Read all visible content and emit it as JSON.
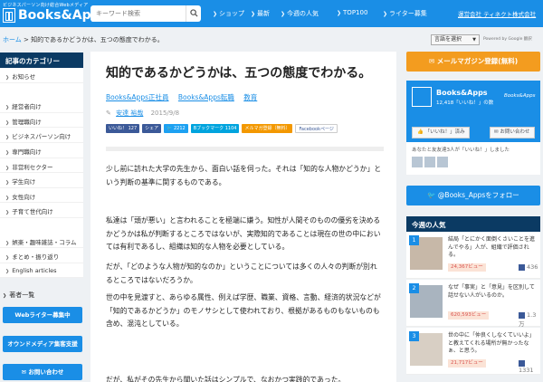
{
  "header": {
    "tagline": "ビジネスパーソン向け総合Webメディア",
    "logo": "Books&Apps",
    "search_placeholder": "キーワード検索",
    "nav": [
      "ショップ",
      "最新",
      "今週の人気",
      "TOP100",
      "ライター募集"
    ],
    "company": "運営会社 ティネクト株式会社"
  },
  "breadcrumb": {
    "home": "ホーム",
    "sep": ">",
    "current": "知的であるかどうかは、五つの態度でわかる。"
  },
  "translate": {
    "select_label": "言語を選択",
    "powered": "Powered by Google 翻訳"
  },
  "left": {
    "categories_title": "記事のカテゴリー",
    "categories": [
      "お知らせ",
      "経営者向け",
      "管理職向け",
      "ビジネスパーソン向け",
      "専門職向け",
      "非営利セクター",
      "学生向け",
      "女性向け",
      "子育て世代向け",
      "娯楽・趣味雑誌・コラム",
      "まとめ・振り返り",
      "English articles"
    ],
    "authors_label": "著者一覧",
    "buttons": [
      "Webライター募集中",
      "オウンドメディア集客支援",
      "お問い合わせ"
    ]
  },
  "article": {
    "title": "知的であるかどうかは、五つの態度でわかる。",
    "tags": [
      "Books&Apps正社員",
      "Books&Apps転職",
      "教育"
    ],
    "author": "安達 裕哉",
    "date": "2015/9/8",
    "shares": {
      "like": "いいね！ 127",
      "share": "シェア",
      "tweet": "2212",
      "hatena": "Bブックマーク 1104",
      "mail": "メルマガ登録（無料）",
      "facebook_page": "Facebookページ"
    },
    "paragraphs": [
      "少し前に訪れた大学の先生から、面白い話を伺った。それは「知的な人物かどうか」という判断の基準に関するものである。",
      "私達は「頭が悪い」と言われることを極端に嫌う。知性が人間そのものの優劣を決めるかどうかは私が判断するところではないが、実際知的であることは現在の世の中においては有利であるし、組織は知的な人物を必要としている。",
      "だが、「どのような人物が知的なのか」ということについては多くの人々の判断が別れるところではないだろうか。",
      "世の中を見渡すと、あらゆる属性、例えば学歴、職業、資格、言動、経済的状況などが「知的であるかどうか」のモノサシとして使われており、根拠があるものもないものも含め、混沌としている。",
      "だが、私がその先生から聞いた話はシンプルで、なおかつ実践的であった。"
    ]
  },
  "right": {
    "mailmag": "メールマガジン登録(無料)",
    "fb": {
      "name": "Books&Apps",
      "likes": "12,418「いいね！」の数",
      "brand": "Books&Apps",
      "like_btn": "「いいね！」済み",
      "contact_btn": "お問い合わせ",
      "friends": "あなたと友友達3人が「いいね！」しました"
    },
    "twitter": "@Books_Appsをフォロー",
    "popular_title": "今週の人気",
    "popular": [
      {
        "rank": "1",
        "title": "結局「とにかく面倒くさいことを進んでやる」人が、組織で評価される。",
        "views": "24,367ビュー",
        "fb": "436"
      },
      {
        "rank": "2",
        "title": "なぜ「事実」と「意見」を区別して話せない人がいるのか。",
        "views": "620,593ビュー",
        "fb": "1.3万"
      },
      {
        "rank": "3",
        "title": "世の中に「仲良くしなくていいよ」と教えてくれる場所が無かったなぁ、と思う。",
        "views": "21,717ビュー",
        "fb": "1331"
      }
    ]
  }
}
